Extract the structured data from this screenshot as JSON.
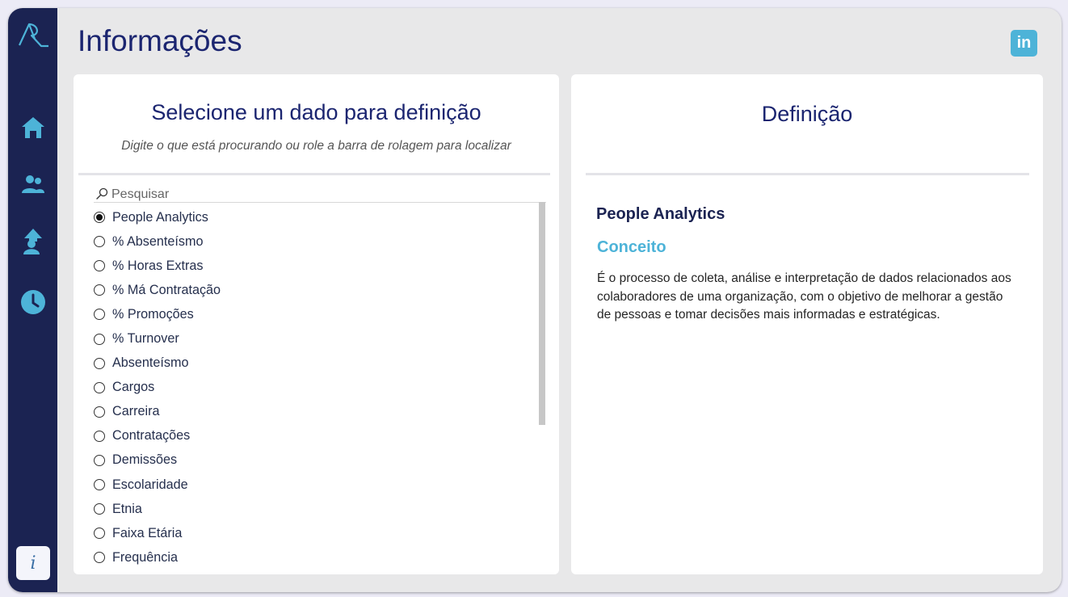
{
  "header": {
    "title": "Informações",
    "linkedin_label": "in"
  },
  "sidebar": {
    "items": [
      {
        "name": "home",
        "icon": "home-icon"
      },
      {
        "name": "people",
        "icon": "users-icon"
      },
      {
        "name": "promotion",
        "icon": "person-arrow-up-icon"
      },
      {
        "name": "history",
        "icon": "clock-icon"
      }
    ],
    "info_label": "i"
  },
  "left_card": {
    "title": "Selecione um dado para definição",
    "subtitle": "Digite o que está procurando ou role a barra de rolagem para localizar",
    "search_placeholder": "Pesquisar",
    "items": [
      {
        "label": "People Analytics",
        "selected": true
      },
      {
        "label": "% Absenteísmo",
        "selected": false
      },
      {
        "label": "% Horas Extras",
        "selected": false
      },
      {
        "label": "% Má Contratação",
        "selected": false
      },
      {
        "label": "% Promoções",
        "selected": false
      },
      {
        "label": "% Turnover",
        "selected": false
      },
      {
        "label": "Absenteísmo",
        "selected": false
      },
      {
        "label": "Cargos",
        "selected": false
      },
      {
        "label": "Carreira",
        "selected": false
      },
      {
        "label": "Contratações",
        "selected": false
      },
      {
        "label": "Demissões",
        "selected": false
      },
      {
        "label": "Escolaridade",
        "selected": false
      },
      {
        "label": "Etnia",
        "selected": false
      },
      {
        "label": "Faixa Etária",
        "selected": false
      },
      {
        "label": "Frequência",
        "selected": false
      }
    ]
  },
  "right_card": {
    "title": "Definição",
    "term": "People Analytics",
    "concept_label": "Conceito",
    "definition": "É o processo de coleta, análise e interpretação de dados relacionados aos colaboradores de uma organização, com o objetivo de melhorar a gestão de pessoas e tomar decisões mais informadas e estratégicas."
  },
  "colors": {
    "sidebar": "#1b2352",
    "accent": "#4db3d8",
    "title": "#1b2570",
    "background": "#e8e8e9"
  }
}
